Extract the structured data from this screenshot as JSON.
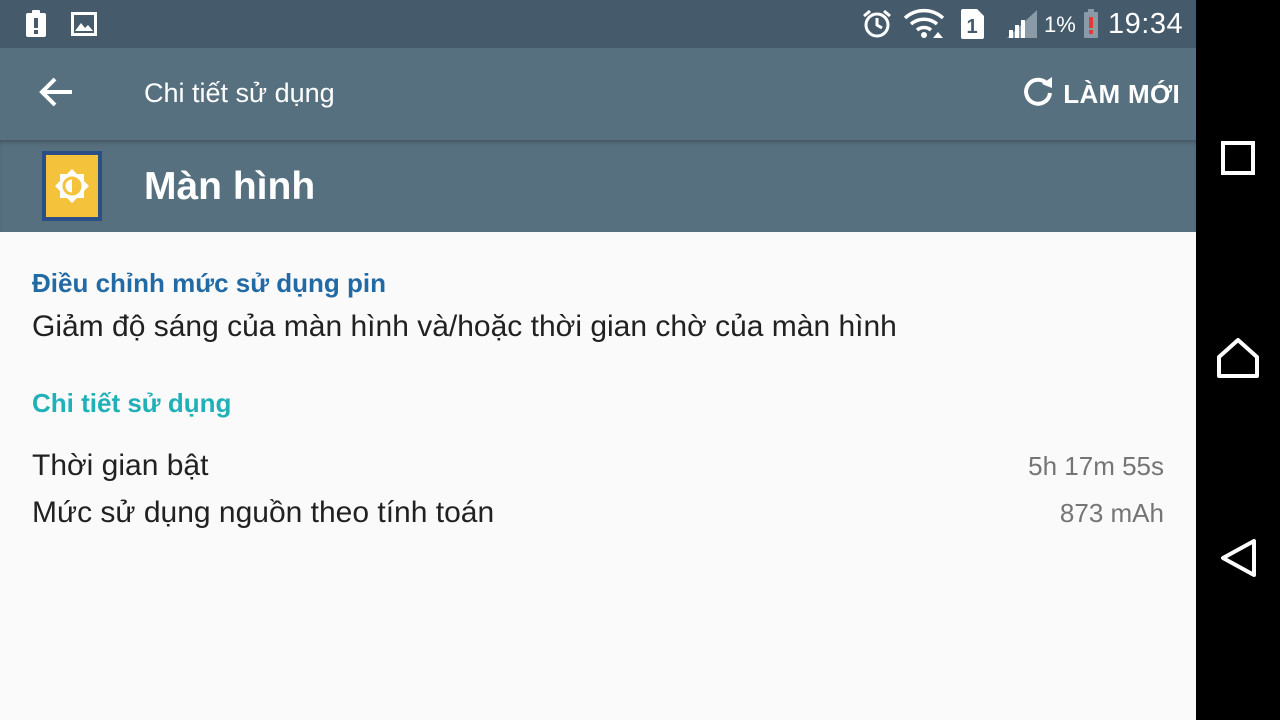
{
  "status_bar": {
    "battery_percent": "1%",
    "time": "19:34",
    "sim_slot": "1",
    "icons": [
      "warning-icon",
      "gallery-icon",
      "alarm-icon",
      "wifi-icon",
      "sim-icon",
      "signal-icon",
      "battery-icon"
    ]
  },
  "toolbar": {
    "title": "Chi tiết sử dụng",
    "refresh_label": "LÀM MỚI",
    "icons": [
      "back-arrow-icon",
      "refresh-icon"
    ]
  },
  "header": {
    "app_name": "Màn hình",
    "icon": "brightness-icon"
  },
  "tip": {
    "title": "Điều chỉnh mức sử dụng pin",
    "text": "Giảm độ sáng của màn hình và/hoặc thời gian chờ của màn hình"
  },
  "details": {
    "title": "Chi tiết sử dụng",
    "rows": [
      {
        "label": "Thời gian bật",
        "value": "5h 17m 55s"
      },
      {
        "label": "Mức sử dụng nguồn theo tính toán",
        "value": "873 mAh"
      }
    ]
  },
  "nav": {
    "icons": [
      "recents-icon",
      "home-icon",
      "back-icon"
    ]
  },
  "colors": {
    "status_bar": "#455a6b",
    "app_bar": "#57707f",
    "tip_title": "#216aa4",
    "details_title": "#1fb0b8",
    "icon_yellow": "#f5c33b"
  }
}
